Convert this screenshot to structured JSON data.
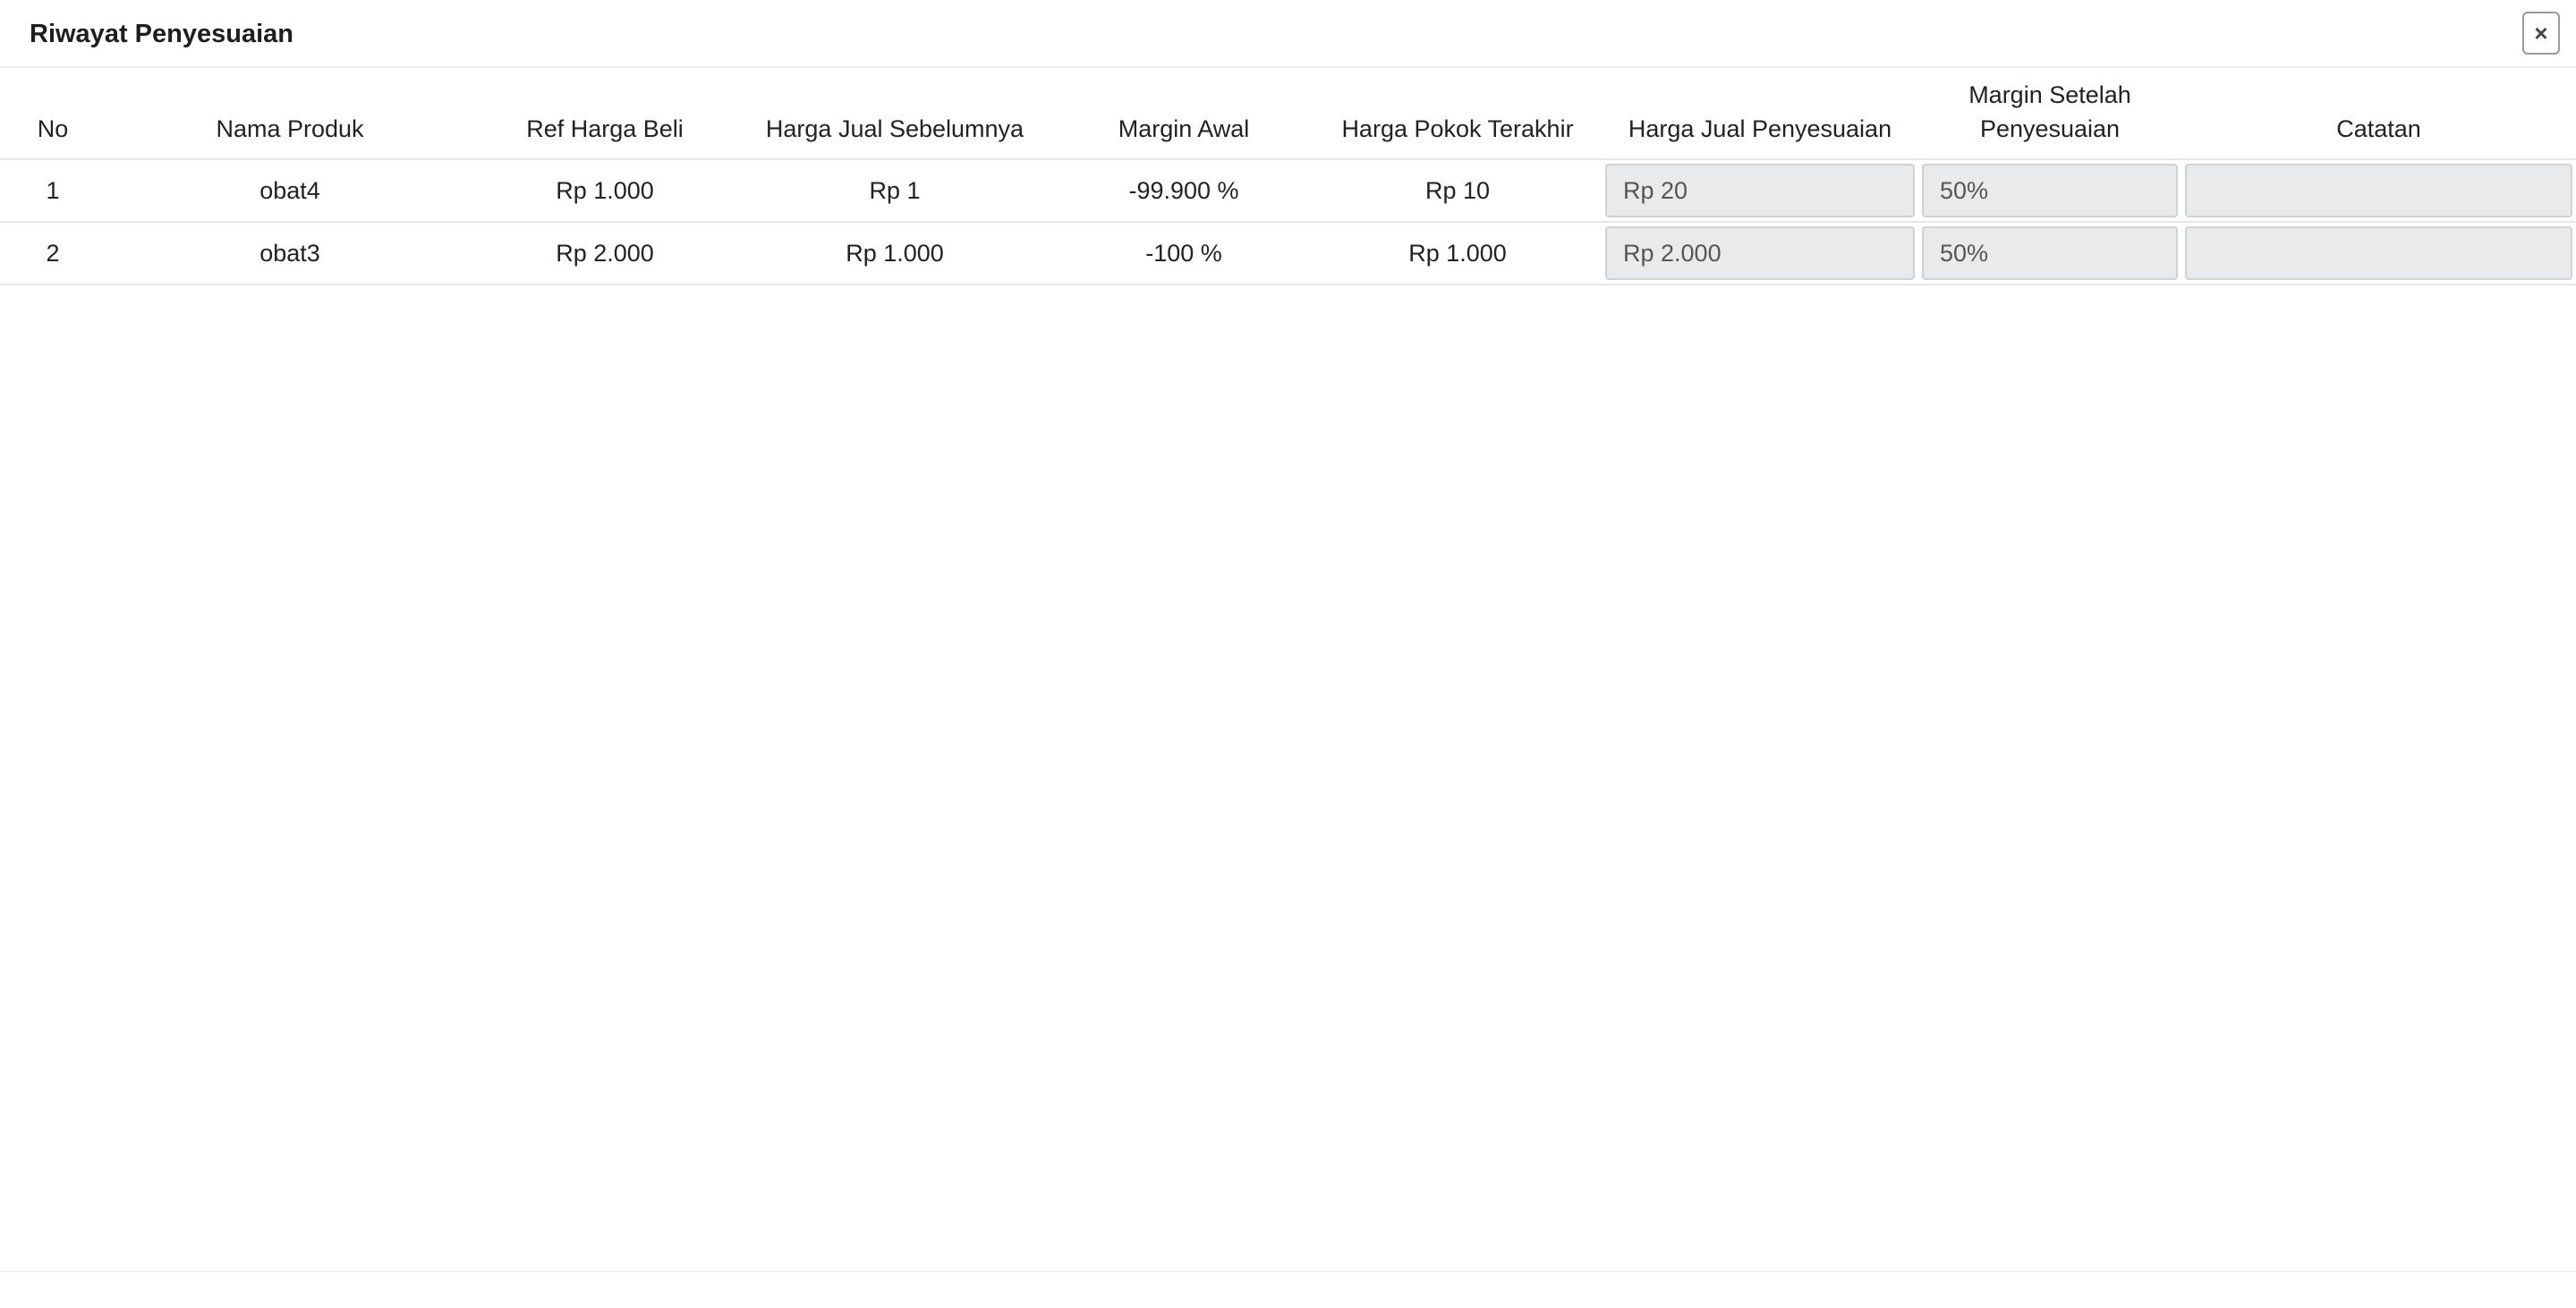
{
  "modal": {
    "title": "Riwayat Penyesuaian",
    "close_label": "×"
  },
  "table": {
    "headers": {
      "no": "No",
      "product_name": "Nama Produk",
      "ref_buy_price": "Ref Harga Beli",
      "prev_sell_price": "Harga Jual Sebelumnya",
      "initial_margin": "Margin Awal",
      "last_cost_price": "Harga Pokok Terakhir",
      "adjusted_sell_price": "Harga Jual Penyesuaian",
      "margin_after_line1": "Margin Setelah",
      "margin_after_line2": "Penyesuaian",
      "notes": "Catatan"
    },
    "rows": [
      {
        "no": "1",
        "product_name": "obat4",
        "ref_buy_price": "Rp 1.000",
        "prev_sell_price": "Rp 1",
        "initial_margin": "-99.900 %",
        "last_cost_price": "Rp 10",
        "adjusted_sell_price": "Rp 20",
        "margin_after": "50%",
        "notes": ""
      },
      {
        "no": "2",
        "product_name": "obat3",
        "ref_buy_price": "Rp 2.000",
        "prev_sell_price": "Rp 1.000",
        "initial_margin": "-100 %",
        "last_cost_price": "Rp 1.000",
        "adjusted_sell_price": "Rp 2.000",
        "margin_after": "50%",
        "notes": ""
      }
    ]
  }
}
